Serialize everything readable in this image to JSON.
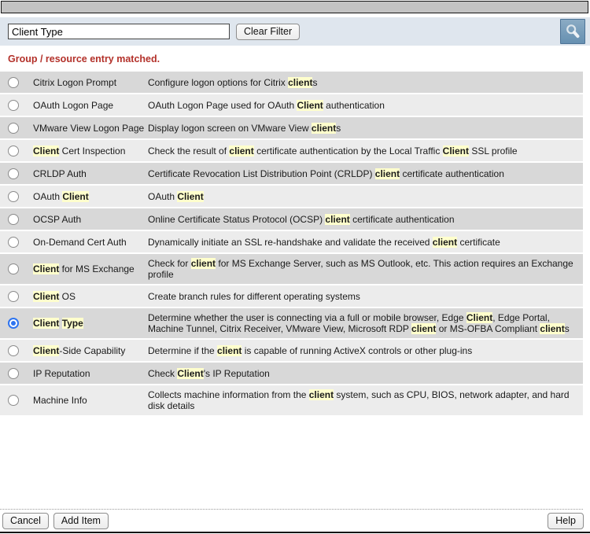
{
  "titlebar": {
    "title": ""
  },
  "filter_bar": {
    "input_value": "Client Type",
    "clear_button_label": "Clear Filter",
    "search_icon": "magnifier-icon"
  },
  "status_message": "Group / resource entry matched.",
  "list": {
    "rows": [
      {
        "selected": false,
        "name": [
          {
            "t": "Citrix Logon Prompt",
            "h": false
          }
        ],
        "desc": [
          {
            "t": "Configure logon options for Citrix ",
            "h": false
          },
          {
            "t": "client",
            "h": true
          },
          {
            "t": "s",
            "h": false
          }
        ]
      },
      {
        "selected": false,
        "name": [
          {
            "t": "OAuth Logon Page",
            "h": false
          }
        ],
        "desc": [
          {
            "t": "OAuth Logon Page used for OAuth ",
            "h": false
          },
          {
            "t": "Client",
            "h": true
          },
          {
            "t": " authentication",
            "h": false
          }
        ]
      },
      {
        "selected": false,
        "name": [
          {
            "t": "VMware View Logon Page",
            "h": false
          }
        ],
        "desc": [
          {
            "t": "Display logon screen on VMware View ",
            "h": false
          },
          {
            "t": "client",
            "h": true
          },
          {
            "t": "s",
            "h": false
          }
        ]
      },
      {
        "selected": false,
        "name": [
          {
            "t": "Client",
            "h": true
          },
          {
            "t": " Cert Inspection",
            "h": false
          }
        ],
        "desc": [
          {
            "t": "Check the result of ",
            "h": false
          },
          {
            "t": "client",
            "h": true
          },
          {
            "t": " certificate authentication by the Local Traffic ",
            "h": false
          },
          {
            "t": "Client",
            "h": true
          },
          {
            "t": " SSL profile",
            "h": false
          }
        ]
      },
      {
        "selected": false,
        "name": [
          {
            "t": "CRLDP Auth",
            "h": false
          }
        ],
        "desc": [
          {
            "t": "Certificate Revocation List Distribution Point (CRLDP) ",
            "h": false
          },
          {
            "t": "client",
            "h": true
          },
          {
            "t": " certificate authentication",
            "h": false
          }
        ]
      },
      {
        "selected": false,
        "name": [
          {
            "t": "OAuth ",
            "h": false
          },
          {
            "t": "Client",
            "h": true
          }
        ],
        "desc": [
          {
            "t": "OAuth ",
            "h": false
          },
          {
            "t": "Client",
            "h": true
          }
        ]
      },
      {
        "selected": false,
        "name": [
          {
            "t": "OCSP Auth",
            "h": false
          }
        ],
        "desc": [
          {
            "t": "Online Certificate Status Protocol (OCSP) ",
            "h": false
          },
          {
            "t": "client",
            "h": true
          },
          {
            "t": " certificate authentication",
            "h": false
          }
        ]
      },
      {
        "selected": false,
        "name": [
          {
            "t": "On-Demand Cert Auth",
            "h": false
          }
        ],
        "desc": [
          {
            "t": "Dynamically initiate an SSL re-handshake and validate the received ",
            "h": false
          },
          {
            "t": "client",
            "h": true
          },
          {
            "t": " certificate",
            "h": false
          }
        ]
      },
      {
        "selected": false,
        "name": [
          {
            "t": "Client",
            "h": true
          },
          {
            "t": " for MS Exchange",
            "h": false
          }
        ],
        "desc": [
          {
            "t": "Check for ",
            "h": false
          },
          {
            "t": "client",
            "h": true
          },
          {
            "t": " for MS Exchange Server, such as MS Outlook, etc. This action requires an Exchange profile",
            "h": false
          }
        ]
      },
      {
        "selected": false,
        "name": [
          {
            "t": "Client",
            "h": true
          },
          {
            "t": " OS",
            "h": false
          }
        ],
        "desc": [
          {
            "t": "Create branch rules for different operating systems",
            "h": false
          }
        ]
      },
      {
        "selected": true,
        "name": [
          {
            "t": "Client",
            "h": true
          },
          {
            "t": " ",
            "h": false
          },
          {
            "t": "Type",
            "h": true
          }
        ],
        "desc": [
          {
            "t": "Determine whether the user is connecting via a full or mobile browser, Edge ",
            "h": false
          },
          {
            "t": "Client",
            "h": true
          },
          {
            "t": ", Edge Portal, Machine Tunnel, Citrix Receiver, VMware View, Microsoft RDP ",
            "h": false
          },
          {
            "t": "client",
            "h": true
          },
          {
            "t": " or MS-OFBA Compliant ",
            "h": false
          },
          {
            "t": "client",
            "h": true
          },
          {
            "t": "s",
            "h": false
          }
        ]
      },
      {
        "selected": false,
        "name": [
          {
            "t": "Client",
            "h": true
          },
          {
            "t": "-Side Capability",
            "h": false
          }
        ],
        "desc": [
          {
            "t": "Determine if the ",
            "h": false
          },
          {
            "t": "client",
            "h": true
          },
          {
            "t": " is capable of running ActiveX controls or other plug-ins",
            "h": false
          }
        ]
      },
      {
        "selected": false,
        "name": [
          {
            "t": "IP Reputation",
            "h": false
          }
        ],
        "desc": [
          {
            "t": "Check ",
            "h": false
          },
          {
            "t": "Client",
            "h": true
          },
          {
            "t": "'s IP Reputation",
            "h": false
          }
        ]
      },
      {
        "selected": false,
        "name": [
          {
            "t": "Machine Info",
            "h": false
          }
        ],
        "desc": [
          {
            "t": "Collects machine information from the ",
            "h": false
          },
          {
            "t": "client",
            "h": true
          },
          {
            "t": " system, such as CPU, BIOS, network adapter, and hard disk details",
            "h": false
          }
        ]
      }
    ]
  },
  "footer": {
    "cancel_label": "Cancel",
    "add_item_label": "Add Item",
    "help_label": "Help"
  },
  "colors": {
    "titlebar_gray": "#c3c3c3",
    "filter_bar_bg": "#dfe6ee",
    "search_button_blue": "#6690b1",
    "message_red": "#b3312a",
    "row_dark": "#d8d8d8",
    "row_light": "#ececec",
    "match_highlight": "#ffffcc",
    "radio_selected_blue": "#2e74f0"
  }
}
